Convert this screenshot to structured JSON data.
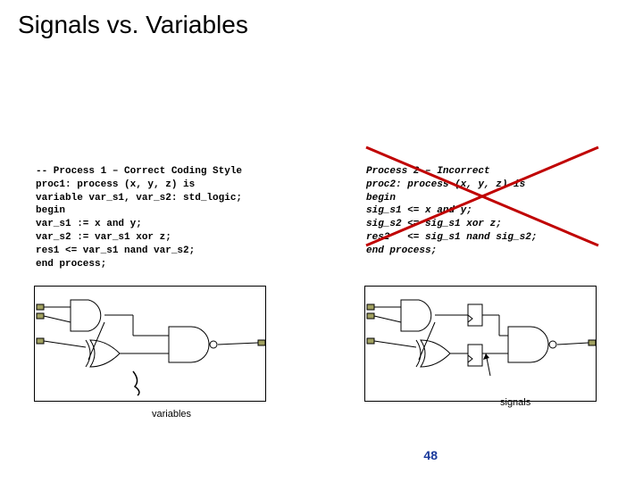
{
  "title": "Signals vs. Variables",
  "process1": {
    "l1": "-- Process 1 – Correct Coding Style",
    "l2": "proc1: process (x, y, z) is",
    "l3": "variable var_s1, var_s2: std_logic;",
    "l4": "begin",
    "l5": "var_s1 := x and y;",
    "l6": "var_s2 := var_s1 xor z;",
    "l7": "res1 <= var_s1 nand var_s2;",
    "l8": "end process;"
  },
  "process2": {
    "l1": "Process 2 – Incorrect",
    "l2": "proc2: process (x, y, z) is",
    "l3": "begin",
    "l4": "sig_s1 <= x and y;",
    "l5": "sig_s2 <= sig_s1 xor z;",
    "l6": "res2   <= sig_s1 nand sig_s2;",
    "l7": "end process;"
  },
  "caption1": "variables",
  "caption2": "signals",
  "pagenum": "48"
}
